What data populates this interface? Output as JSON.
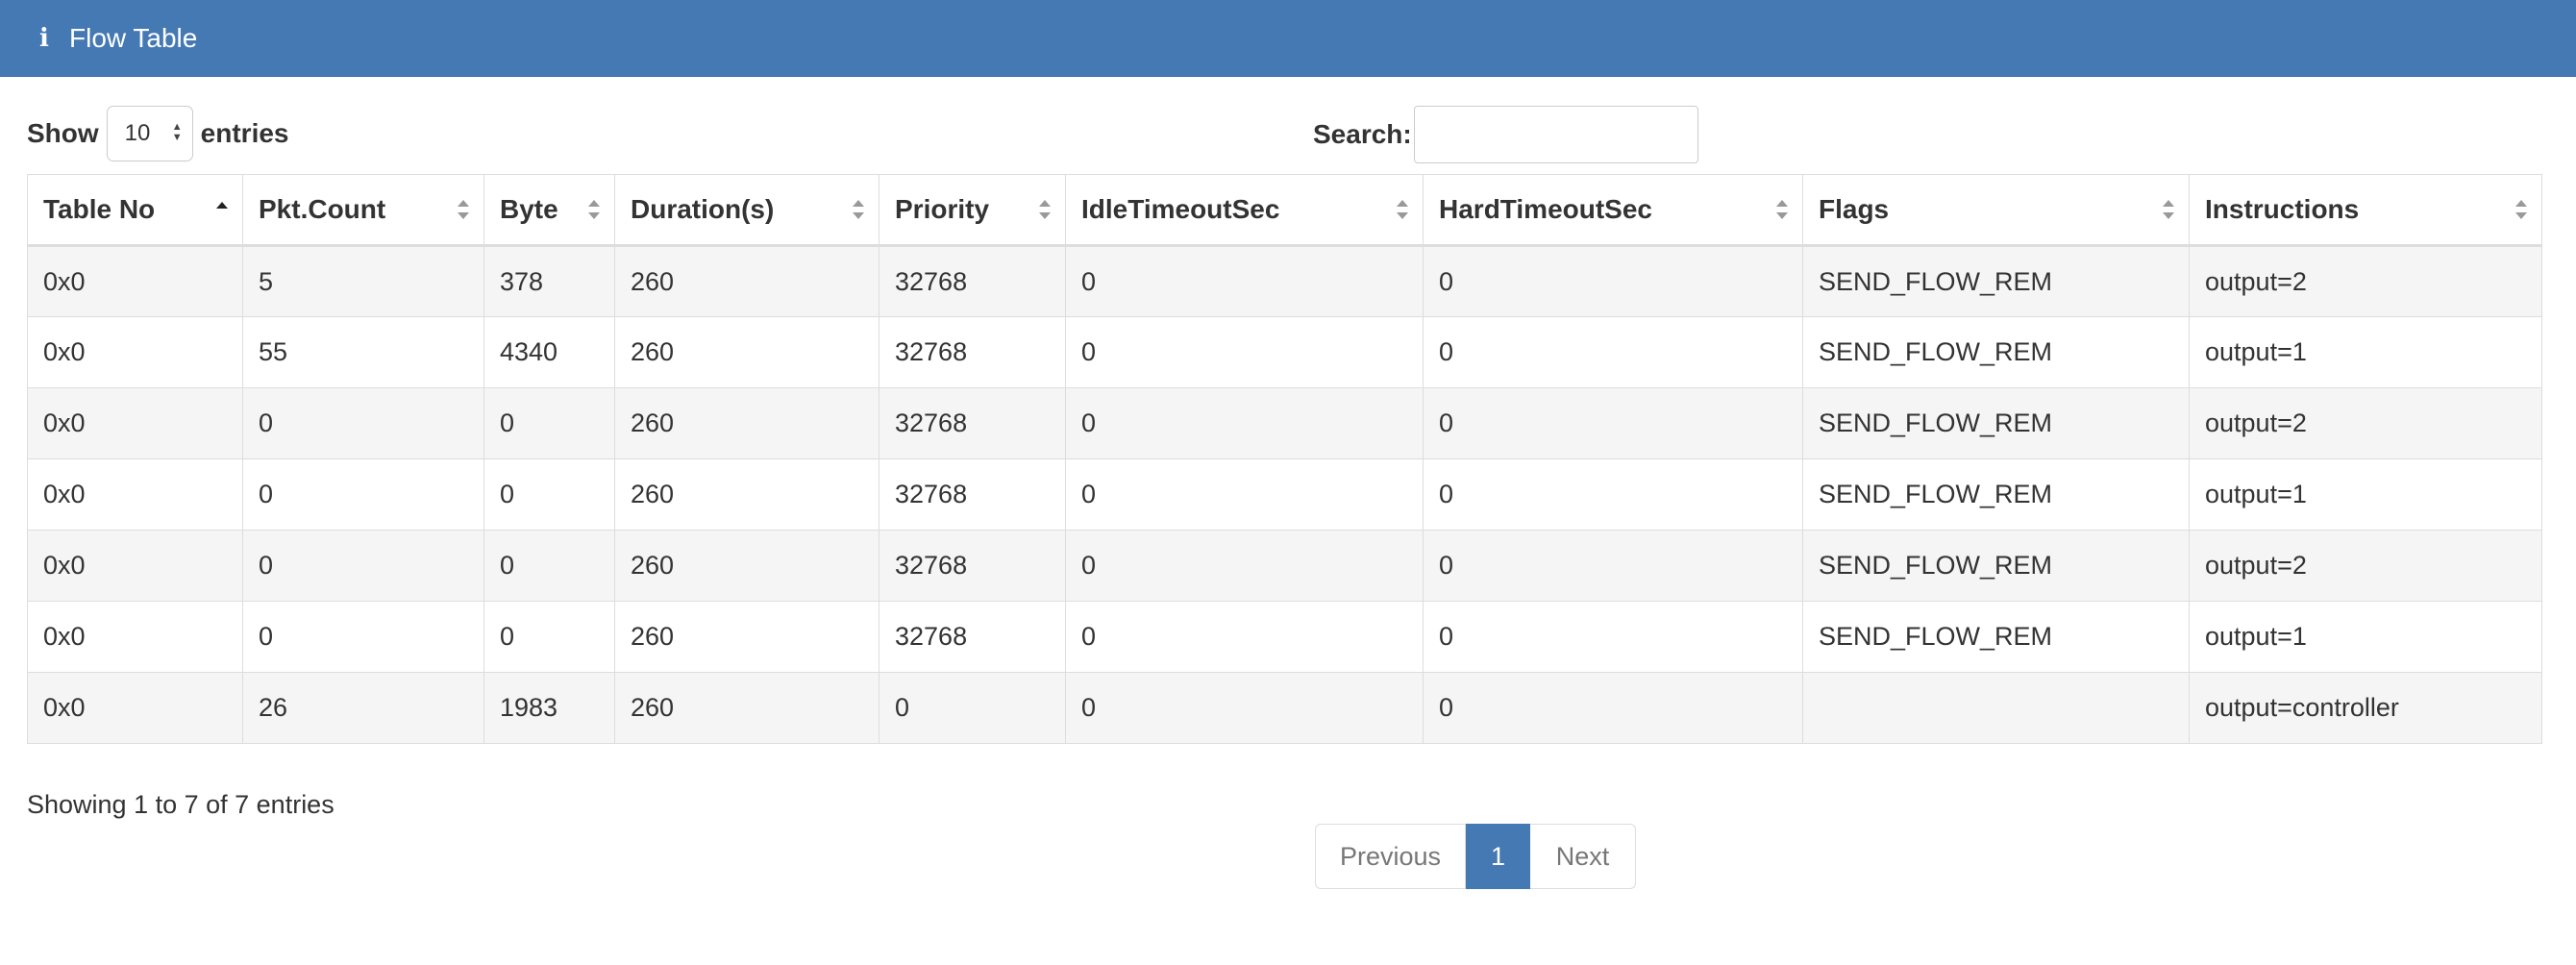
{
  "panel": {
    "icon": "info-icon",
    "title": "Flow Table",
    "heading_color": "#4579b4"
  },
  "length_menu": {
    "prefix": "Show",
    "selected": "10",
    "suffix": "entries"
  },
  "search": {
    "label": "Search:",
    "value": ""
  },
  "table": {
    "columns": [
      {
        "label": "Table No",
        "sort": "asc"
      },
      {
        "label": "Pkt.Count",
        "sort": "none"
      },
      {
        "label": "Byte",
        "sort": "none"
      },
      {
        "label": "Duration(s)",
        "sort": "none"
      },
      {
        "label": "Priority",
        "sort": "none"
      },
      {
        "label": "IdleTimeoutSec",
        "sort": "none"
      },
      {
        "label": "HardTimeoutSec",
        "sort": "none"
      },
      {
        "label": "Flags",
        "sort": "none"
      },
      {
        "label": "Instructions",
        "sort": "none"
      }
    ],
    "rows": [
      [
        "0x0",
        "5",
        "378",
        "260",
        "32768",
        "0",
        "0",
        "SEND_FLOW_REM",
        "output=2"
      ],
      [
        "0x0",
        "55",
        "4340",
        "260",
        "32768",
        "0",
        "0",
        "SEND_FLOW_REM",
        "output=1"
      ],
      [
        "0x0",
        "0",
        "0",
        "260",
        "32768",
        "0",
        "0",
        "SEND_FLOW_REM",
        "output=2"
      ],
      [
        "0x0",
        "0",
        "0",
        "260",
        "32768",
        "0",
        "0",
        "SEND_FLOW_REM",
        "output=1"
      ],
      [
        "0x0",
        "0",
        "0",
        "260",
        "32768",
        "0",
        "0",
        "SEND_FLOW_REM",
        "output=2"
      ],
      [
        "0x0",
        "0",
        "0",
        "260",
        "32768",
        "0",
        "0",
        "SEND_FLOW_REM",
        "output=1"
      ],
      [
        "0x0",
        "26",
        "1983",
        "260",
        "0",
        "0",
        "0",
        "",
        "output=controller"
      ]
    ]
  },
  "footer": {
    "info": "Showing 1 to 7 of 7 entries",
    "pagination": {
      "previous": "Previous",
      "current": "1",
      "next": "Next"
    }
  }
}
